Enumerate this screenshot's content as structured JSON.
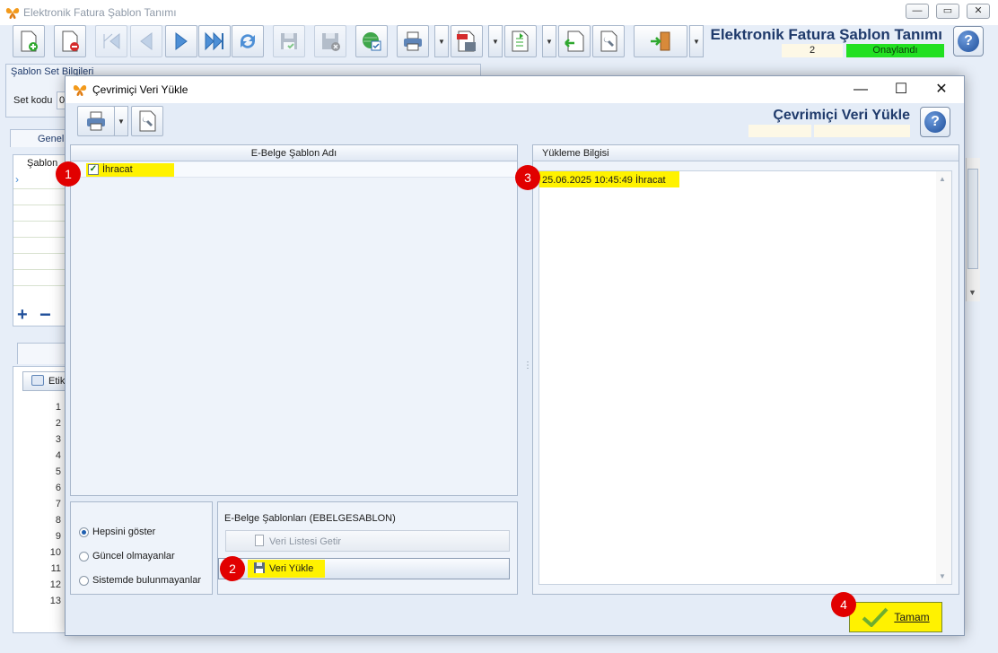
{
  "background_window": {
    "title": "Elektronik Fatura Şablon Tanımı",
    "heading": "Elektronik Fatura Şablon Tanımı",
    "record_count": "2",
    "status": "Onaylandı",
    "group_title": "Şablon Set Bilgileri",
    "set_kodu_label": "Set kodu",
    "set_kodu_value": "0",
    "tab_genel": "Genel",
    "grid_header": "Şablon",
    "etiket_button": "Etik",
    "line_numbers": [
      "1",
      "2",
      "3",
      "4",
      "5",
      "6",
      "7",
      "8",
      "9",
      "10",
      "11",
      "12",
      "13"
    ],
    "window_controls": [
      "—",
      "▭",
      "✕"
    ]
  },
  "dialog": {
    "title": "Çevrimiçi Veri Yükle",
    "heading": "Çevrimiçi Veri Yükle",
    "window_controls": [
      "—",
      "☐",
      "✕"
    ],
    "left_panel": {
      "header": "E-Belge Şablon Adı",
      "rows": [
        {
          "checked": true,
          "label": "İhracat"
        }
      ]
    },
    "right_panel": {
      "header": "Yükleme Bilgisi",
      "log": "25.06.2025 10:45:49 İhracat"
    },
    "filter": {
      "options": [
        "Hepsini göster",
        "Güncel olmayanlar",
        "Sistemde bulunmayanlar"
      ],
      "selected": "Hepsini göster"
    },
    "ebelge_group": {
      "title": "E-Belge Şablonları (EBELGESABLON)",
      "list_button": "Veri Listesi Getir",
      "load_button": "Veri Yükle"
    },
    "ok_button": "Tamam"
  },
  "markers": [
    "1",
    "2",
    "3",
    "4"
  ],
  "colors": {
    "highlight": "#fff200",
    "marker": "#e10000",
    "status_green": "#22e022",
    "heading_blue": "#1f3a6b"
  }
}
